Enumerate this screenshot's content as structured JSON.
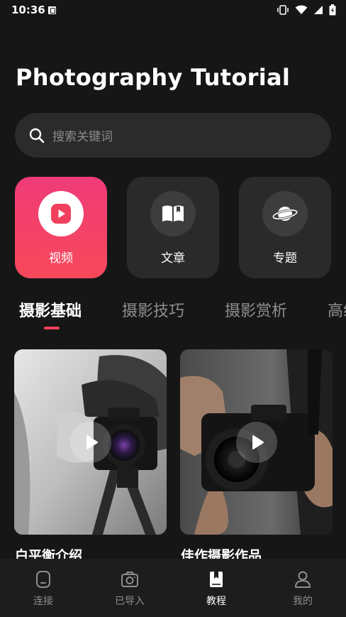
{
  "status_bar": {
    "time": "10:36"
  },
  "header": {
    "title": "Photography Tutorial"
  },
  "search": {
    "placeholder": "搜索关键词"
  },
  "categories": [
    {
      "label": "视频",
      "icon": "play-icon",
      "active": true
    },
    {
      "label": "文章",
      "icon": "book-icon",
      "active": false
    },
    {
      "label": "专题",
      "icon": "planet-icon",
      "active": false
    }
  ],
  "tabs": [
    {
      "label": "摄影基础",
      "active": true
    },
    {
      "label": "摄影技巧",
      "active": false
    },
    {
      "label": "摄影赏析",
      "active": false
    },
    {
      "label": "高级",
      "active": false
    }
  ],
  "videos": [
    {
      "title": "白平衡介绍"
    },
    {
      "title": "佳作摄影作品"
    }
  ],
  "bottom_nav": [
    {
      "label": "连接",
      "icon": "phone-icon",
      "active": false
    },
    {
      "label": "已导入",
      "icon": "camera-icon",
      "active": false
    },
    {
      "label": "教程",
      "icon": "bookmark-book-icon",
      "active": true
    },
    {
      "label": "我的",
      "icon": "person-icon",
      "active": false
    }
  ],
  "colors": {
    "accent": "#f0405e",
    "background": "#161616",
    "card": "#2a2a2a"
  }
}
